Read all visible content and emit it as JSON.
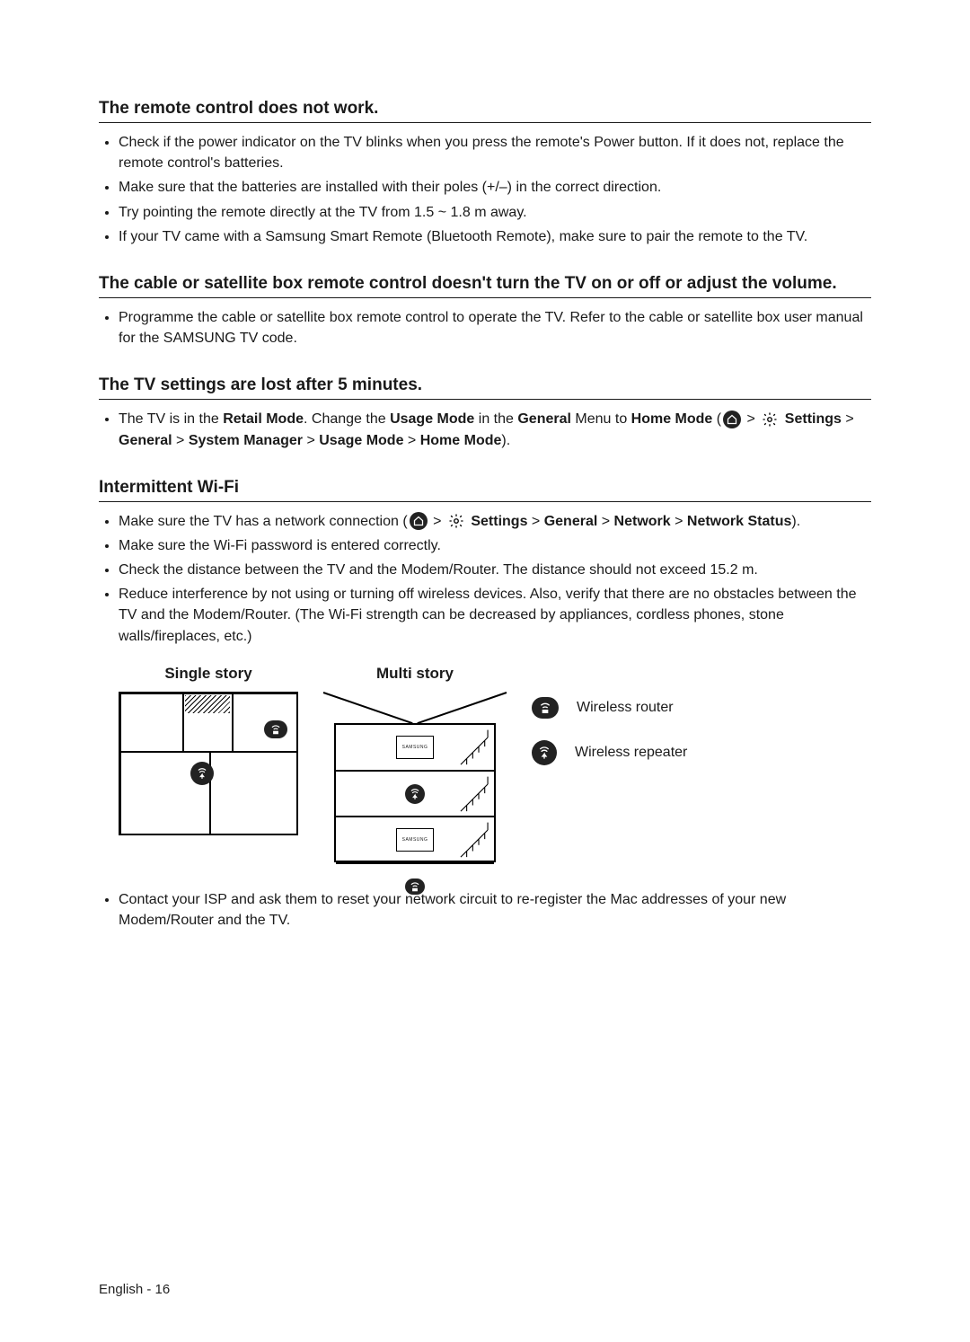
{
  "sections": [
    {
      "heading": "The remote control does not work.",
      "bullets": [
        "Check if the power indicator on the TV blinks when you press the remote's Power button. If it does not, replace the remote control's batteries.",
        "Make sure that the batteries are installed with their poles (+/–) in the correct direction.",
        "Try pointing the remote directly at the TV from 1.5 ~ 1.8 m away.",
        "If your TV came with a Samsung Smart Remote (Bluetooth Remote), make sure to pair the remote to the TV."
      ]
    },
    {
      "heading": "The cable or satellite box remote control doesn't turn the TV on or off or adjust the volume.",
      "bullets": [
        "Programme the cable or satellite box remote control to operate the TV. Refer to the cable or satellite box user manual for the SAMSUNG TV code."
      ]
    }
  ],
  "retail": {
    "heading": "The TV settings are lost after 5 minutes.",
    "pre": "The TV is in the ",
    "b_retail": "Retail Mode",
    "mid1": ". Change the ",
    "b_usage": "Usage Mode",
    "mid2": " in the ",
    "b_general": "General",
    "mid3": " Menu to ",
    "b_home": "Home Mode",
    "open": " (",
    "gt": " > ",
    "b_settings": "Settings",
    "b_general2": "General",
    "b_sysmgr": "System Manager",
    "b_usage2": "Usage Mode",
    "b_home2": "Home Mode",
    "close": ")."
  },
  "wifi": {
    "heading": "Intermittent Wi-Fi",
    "bullet1_pre": "Make sure the TV has a network connection (",
    "gt": " > ",
    "b_settings": "Settings",
    "b_general": "General",
    "b_network": "Network",
    "b_status": "Network Status",
    "bullet1_close": ").",
    "bullets_rest": [
      "Make sure the Wi-Fi password is entered correctly.",
      "Check the distance between the TV and the Modem/Router. The distance should not exceed 15.2 m.",
      "Reduce interference by not using or turning off wireless devices. Also, verify that there are no obstacles between the TV and the Modem/Router. (The Wi-Fi strength can be decreased by appliances, cordless phones, stone walls/fireplaces, etc.)"
    ],
    "bullet_last": "Contact your ISP and ask them to reset your network circuit to re-register the Mac addresses of your new Modem/Router and the TV."
  },
  "diagram": {
    "single_title": "Single story",
    "multi_title": "Multi story",
    "legend_router": "Wireless router",
    "legend_repeater": "Wireless repeater",
    "tv_label": "SAMSUNG"
  },
  "footer": "English - 16"
}
